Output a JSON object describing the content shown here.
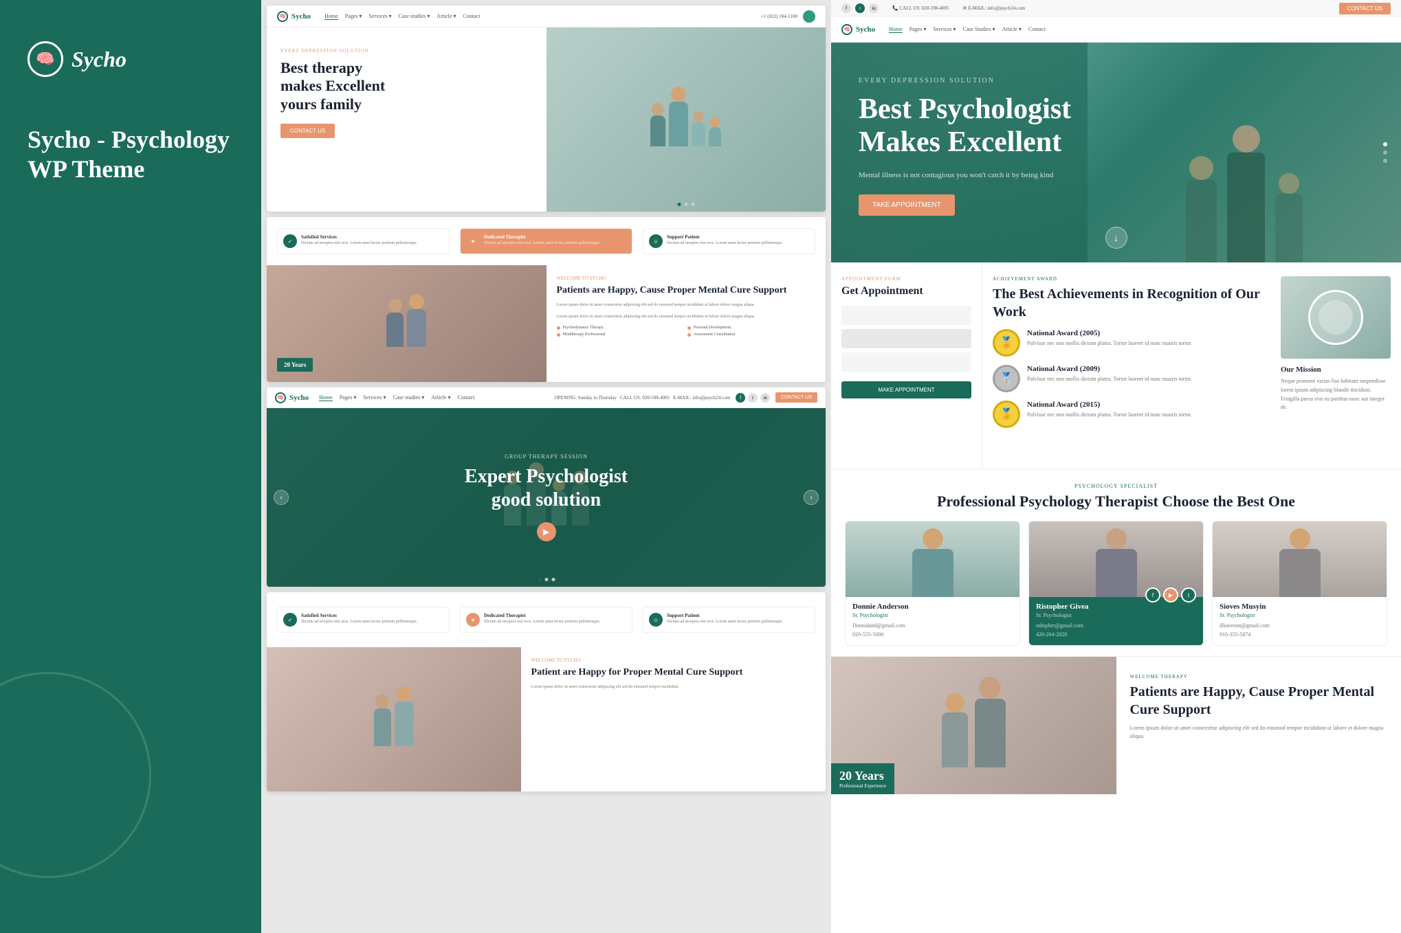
{
  "brand": {
    "logo_icon": "🧠",
    "logo_text": "Sycho",
    "title": "Sycho - Psychology",
    "subtitle": "WP Theme"
  },
  "nav_links": [
    "Home",
    "Pages ▾",
    "Services ▾",
    "Case studies ▾",
    "Article ▾",
    "Contact"
  ],
  "nav_social": [
    "f",
    "t",
    "in"
  ],
  "hero1": {
    "eyebrow": "EVERY DEPRESSION SOLUTION",
    "title1": "Best therapy",
    "title2": "makes Excellent",
    "title3": "yours family",
    "button": "CONTACT US"
  },
  "hero_right": {
    "eyebrow": "EVERY DEPRESSION SOLUTION",
    "title": "Best Psychologist Makes Excellent",
    "subtitle": "Mental illness is not contagious you won't catch it by being kind",
    "button": "TAKE APPOINTMENT"
  },
  "services": [
    {
      "icon": "✓",
      "label": "Satisfied Services",
      "desc": "Dictum ad inceptos nisi eros. Lorem amet lectus pretium pellentesque."
    },
    {
      "icon": "♥",
      "label": "Dedicated Therapist",
      "desc": "Dictum ad inceptos nisi eros. Lorem amet lectus pretium pellentesque."
    },
    {
      "icon": "☺",
      "label": "Support Patient",
      "desc": "Dictum ad inceptos nisi eros. Lorem amet lectus pretium pellentesque."
    }
  ],
  "welcome_section": {
    "eyebrow": "WELCOME TO SYCHO",
    "title": "Patients are Happy, Cause Proper Mental Cure Support",
    "para1": "Lorem ipsum dolor sit amet consectetur adipiscing elit sed do eiusmod tempor incididunt ut labore dolore magna aliqua.",
    "para2": "Lorem ipsum dolor sit amet consectetur adipiscing elit sed do eiusmod tempor incididunt ut labore dolore magna aliqua.",
    "features": [
      "Psychodynamic Therapy",
      "Personal Development",
      "Mindtherapy Professional",
      "Assessment Consultation"
    ],
    "years": "20 Years"
  },
  "screen3": {
    "eyebrow": "Group therapy session",
    "title": "Expert Psychologist\ngood solution"
  },
  "screen4_welcome": {
    "eyebrow": "WELCOME TO SYCHO",
    "title": "Patient are Happy for Proper Mental Cure Support"
  },
  "appointment": {
    "eyebrow": "APPOINTMENT FORM",
    "title": "Get Appointment",
    "button": "MAKE APPOINTMENT"
  },
  "achievements": {
    "eyebrow": "ACHIEVEMENT AWARD",
    "title": "The Best Achievements in Recognition of Our Work",
    "awards": [
      {
        "year": "National Award (2005)",
        "desc": "Pulvinar nec non mollis dictum platea. Tortor laoreet id nunc mauris tortor."
      },
      {
        "year": "National Award (2009)",
        "desc": "Pulvinar nec non mollis dictum platea. Tortor laoreet id nunc mauris tortor."
      },
      {
        "year": "National Award (2015)",
        "desc": "Pulvinar nec non mollis dictum platea. Tortor laoreet id nunc mauris tortor."
      }
    ],
    "mission_title": "Our Mission",
    "mission_text": "Neque pransent varius fias habitant suspendisse lorem ipsum adipiscing blandit tincidunt. Fringilla purus erat eu pariëtas nunc aut integer de."
  },
  "therapists": {
    "eyebrow": "PSYCHOLOGY SPECIALIST",
    "title": "Professional Psychology Therapist Choose the Best One",
    "people": [
      {
        "name": "Donnie Anderson",
        "role": "Sr. Psychologist",
        "email": "Donnidand@gmail.com",
        "phone": "020-555-5000"
      },
      {
        "name": "Ristopher Givea",
        "role": "Sr. Psychologist",
        "email": "ndispher@gmail.com",
        "phone": "420-264-2026",
        "featured": true
      },
      {
        "name": "Sioves Musyin",
        "role": "Sr. Psychologist",
        "email": "dliaversm@gmail.com",
        "phone": "910-355-5874"
      }
    ]
  },
  "patients": {
    "eyebrow": "WELCOME THERAPY",
    "title": "Patients are Happy, Cause Proper Mental Cure Support",
    "text": "Lorem ipsum dolor sit amet consectetur adipiscing elit sed do eiusmod tempor incididunt ut labore et dolore magna aliqua.",
    "years": "20 Years",
    "exp_label": "Professional Experience"
  }
}
